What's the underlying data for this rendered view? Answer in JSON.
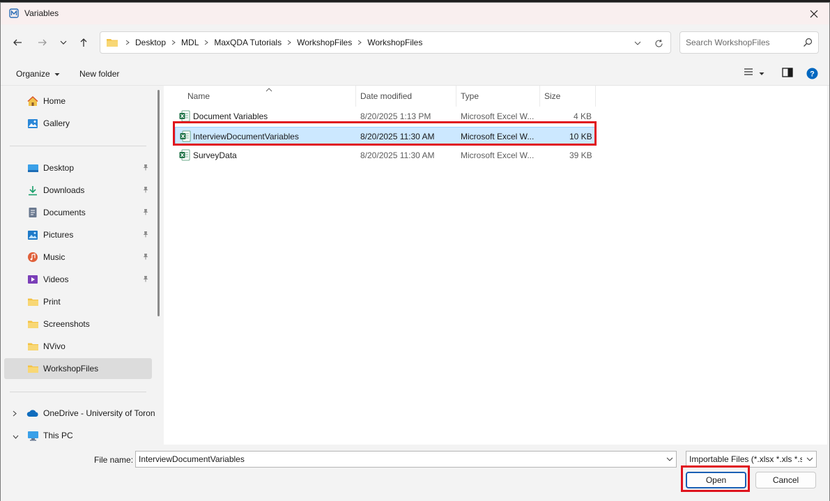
{
  "window": {
    "title": "Variables"
  },
  "nav": {
    "breadcrumbs": [
      "Desktop",
      "MDL",
      "MaxQDA Tutorials",
      "WorkshopFiles",
      "WorkshopFiles"
    ],
    "search_placeholder": "Search WorkshopFiles"
  },
  "command_bar": {
    "organize": "Organize",
    "new_folder": "New folder"
  },
  "sidebar": {
    "top": [
      {
        "label": "Home",
        "icon": "home-icon"
      },
      {
        "label": "Gallery",
        "icon": "gallery-icon"
      }
    ],
    "pinned": [
      {
        "label": "Desktop",
        "icon": "desktop-icon"
      },
      {
        "label": "Downloads",
        "icon": "download-icon"
      },
      {
        "label": "Documents",
        "icon": "documents-icon"
      },
      {
        "label": "Pictures",
        "icon": "pictures-icon"
      },
      {
        "label": "Music",
        "icon": "music-icon"
      },
      {
        "label": "Videos",
        "icon": "videos-icon"
      }
    ],
    "folders": [
      {
        "label": "Print",
        "icon": "folder-icon"
      },
      {
        "label": "Screenshots",
        "icon": "folder-icon"
      },
      {
        "label": "NVivo",
        "icon": "folder-icon"
      },
      {
        "label": "WorkshopFiles",
        "icon": "folder-icon",
        "selected": true
      }
    ],
    "locations": [
      {
        "label": "OneDrive - University of Toron",
        "icon": "onedrive-icon"
      },
      {
        "label": "This PC",
        "icon": "this-pc-icon"
      }
    ]
  },
  "file_list": {
    "columns": [
      "Name",
      "Date modified",
      "Type",
      "Size"
    ],
    "rows": [
      {
        "name": "Document Variables",
        "date": "8/20/2025 1:13 PM",
        "type": "Microsoft Excel W...",
        "size": "4 KB",
        "selected": false
      },
      {
        "name": "InterviewDocumentVariables",
        "date": "8/20/2025 11:30 AM",
        "type": "Microsoft Excel W...",
        "size": "10 KB",
        "selected": true
      },
      {
        "name": "SurveyData",
        "date": "8/20/2025 11:30 AM",
        "type": "Microsoft Excel W...",
        "size": "39 KB",
        "selected": false
      }
    ]
  },
  "footer": {
    "file_name_label": "File name:",
    "file_name_value": "InterviewDocumentVariables",
    "filter": "Importable Files (*.xlsx *.xls *.sav",
    "open": "Open",
    "cancel": "Cancel"
  },
  "colors": {
    "selection": "#cce8ff",
    "highlight": "#e0141e",
    "accent": "#1a5fb4",
    "help": "#0067c0"
  }
}
